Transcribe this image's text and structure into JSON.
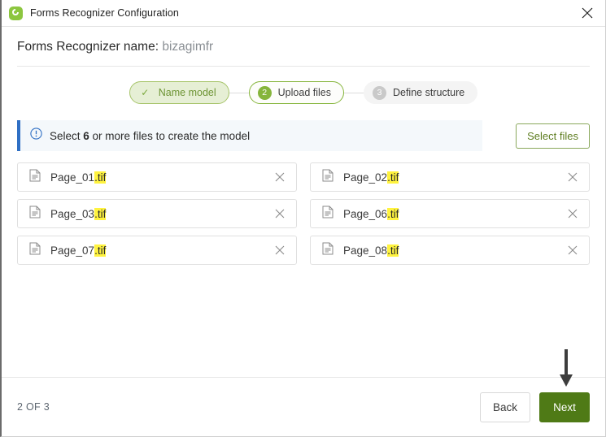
{
  "titlebar": {
    "title": "Forms Recognizer Configuration",
    "app_icon": "forms-recognizer-icon",
    "close_icon": "close-icon"
  },
  "header": {
    "label": "Forms Recognizer name:",
    "value": "bizagimfr"
  },
  "stepper": {
    "steps": [
      {
        "badge": "✓",
        "label": "Name model",
        "state": "done"
      },
      {
        "badge": "2",
        "label": "Upload files",
        "state": "current"
      },
      {
        "badge": "3",
        "label": "Define structure",
        "state": "todo"
      }
    ]
  },
  "info": {
    "icon": "info-circle-icon",
    "text_before": "Select ",
    "text_bold": "6",
    "text_after": " or more files to create the model",
    "accent_color": "#2f6fc4",
    "background_color": "#f4f8fb"
  },
  "actions": {
    "select_files_label": "Select files"
  },
  "files": [
    {
      "name": "Page_01",
      "ext": ".tif",
      "icon": "document-icon",
      "remove_icon": "close-icon"
    },
    {
      "name": "Page_02",
      "ext": ".tif",
      "icon": "document-icon",
      "remove_icon": "close-icon"
    },
    {
      "name": "Page_03",
      "ext": ".tif",
      "icon": "document-icon",
      "remove_icon": "close-icon"
    },
    {
      "name": "Page_06",
      "ext": ".tif",
      "icon": "document-icon",
      "remove_icon": "close-icon"
    },
    {
      "name": "Page_07",
      "ext": ".tif",
      "icon": "document-icon",
      "remove_icon": "close-icon"
    },
    {
      "name": "Page_08",
      "ext": ".tif",
      "icon": "document-icon",
      "remove_icon": "close-icon"
    }
  ],
  "footer": {
    "page_count": "2 OF 3",
    "back_label": "Back",
    "next_label": "Next",
    "next_color": "#4f7a16"
  },
  "annotation": {
    "arrow_icon": "down-arrow-annotation",
    "arrow_color": "#3d3d3d"
  }
}
